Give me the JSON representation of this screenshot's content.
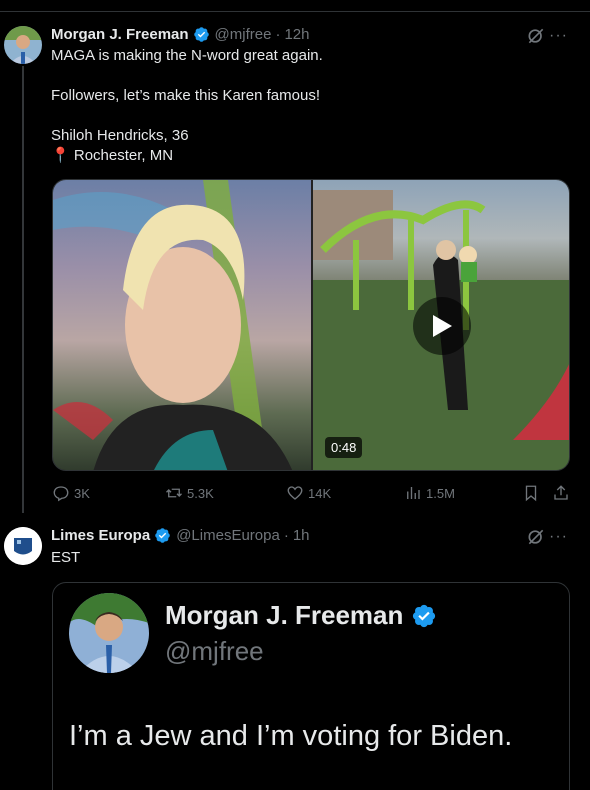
{
  "tweet1": {
    "name": "Morgan J. Freeman",
    "handle": "@mjfree",
    "time": "12h",
    "lines": [
      "MAGA is making the N-word great again.",
      "",
      "Followers, let’s make this Karen famous!",
      "",
      "Shiloh Hendricks, 36",
      "Rochester, MN"
    ],
    "pin_glyph": "📍",
    "video_duration": "0:48",
    "stats": {
      "replies": "3K",
      "reposts": "5.3K",
      "likes": "14K",
      "views": "1.5M"
    }
  },
  "tweet2": {
    "name": "Limes Europa",
    "handle": "@LimesEuropa",
    "time": "1h",
    "text": "EST"
  },
  "quote": {
    "name": "Morgan J. Freeman",
    "handle": "@mjfree",
    "text": "I’m a Jew and I’m voting for Biden."
  },
  "colors": {
    "background": "#000000",
    "text": "#e7e9ea",
    "muted": "#71767b",
    "verified": "#1d9bf0",
    "border": "#2f3336"
  }
}
